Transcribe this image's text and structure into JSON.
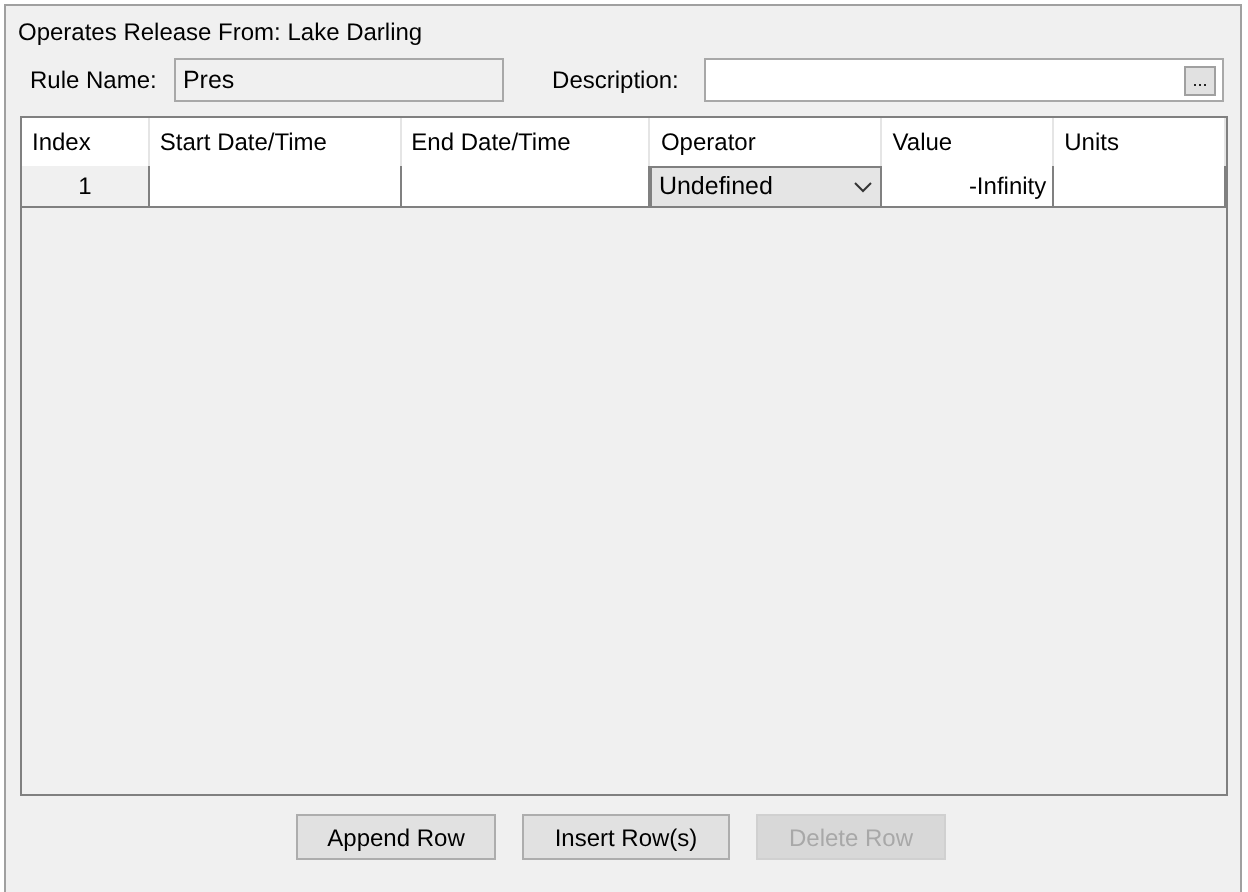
{
  "title": "Operates Release From: Lake Darling",
  "rule_name": {
    "label": "Rule Name:",
    "value": "Pres"
  },
  "description": {
    "label": "Description:",
    "button": "..."
  },
  "table": {
    "columns": [
      "Index",
      "Start Date/Time",
      "End Date/Time",
      "Operator",
      "Value",
      "Units"
    ],
    "rows": [
      {
        "index": "1",
        "start": "",
        "end": "",
        "operator": "Undefined",
        "value": "-Infinity",
        "units": ""
      }
    ]
  },
  "buttons": [
    {
      "label": "Append Row",
      "disabled": false
    },
    {
      "label": "Insert Row(s)",
      "disabled": false
    },
    {
      "label": "Delete Row",
      "disabled": true
    }
  ]
}
